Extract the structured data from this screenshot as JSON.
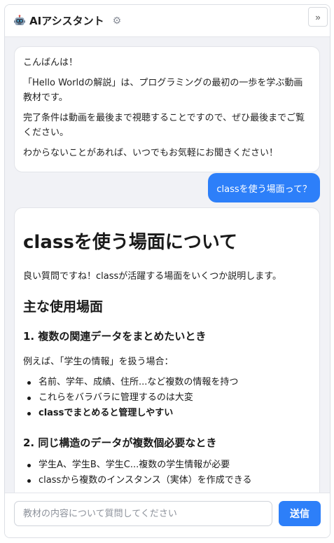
{
  "header": {
    "robot_icon": "robot-icon",
    "title": "AIアシスタント",
    "gear_icon": "⚙",
    "collapse_label": "»"
  },
  "messages": {
    "greeting": [
      "こんばんは！",
      "「Hello Worldの解説」は、プログラミングの最初の一歩を学ぶ動画教材です。",
      "完了条件は動画を最後まで視聴することですので、ぜひ最後までご覧ください。",
      "わからないことがあれば、いつでもお気軽にお聞きください！"
    ],
    "user_question": "classを使う場面って？",
    "answer": {
      "heading": "classを使う場面について",
      "intro": "良い質問ですね！classが活躍する場面をいくつか説明します。",
      "section_title": "主な使用場面",
      "case1": {
        "title": "1. 複数の関連データをまとめたいとき",
        "intro": "例えば、「学生の情報」を扱う場合：",
        "items": [
          "名前、学年、成績、住所...など複数の情報を持つ",
          "これらをバラバラに管理するのは大変",
          "classでまとめると管理しやすい"
        ]
      },
      "case2": {
        "title": "2. 同じ構造のデータが複数個必要なとき",
        "items": [
          "学生A、学生B、学生C...複数の学生情報が必要",
          "classから複数のインスタンス（実体）を作成できる"
        ]
      }
    }
  },
  "input": {
    "placeholder": "教材の内容について質問してください",
    "value": "",
    "send_label": "送信"
  },
  "colors": {
    "accent": "#2d7ff9",
    "panel_bg": "#f1f2f6"
  }
}
